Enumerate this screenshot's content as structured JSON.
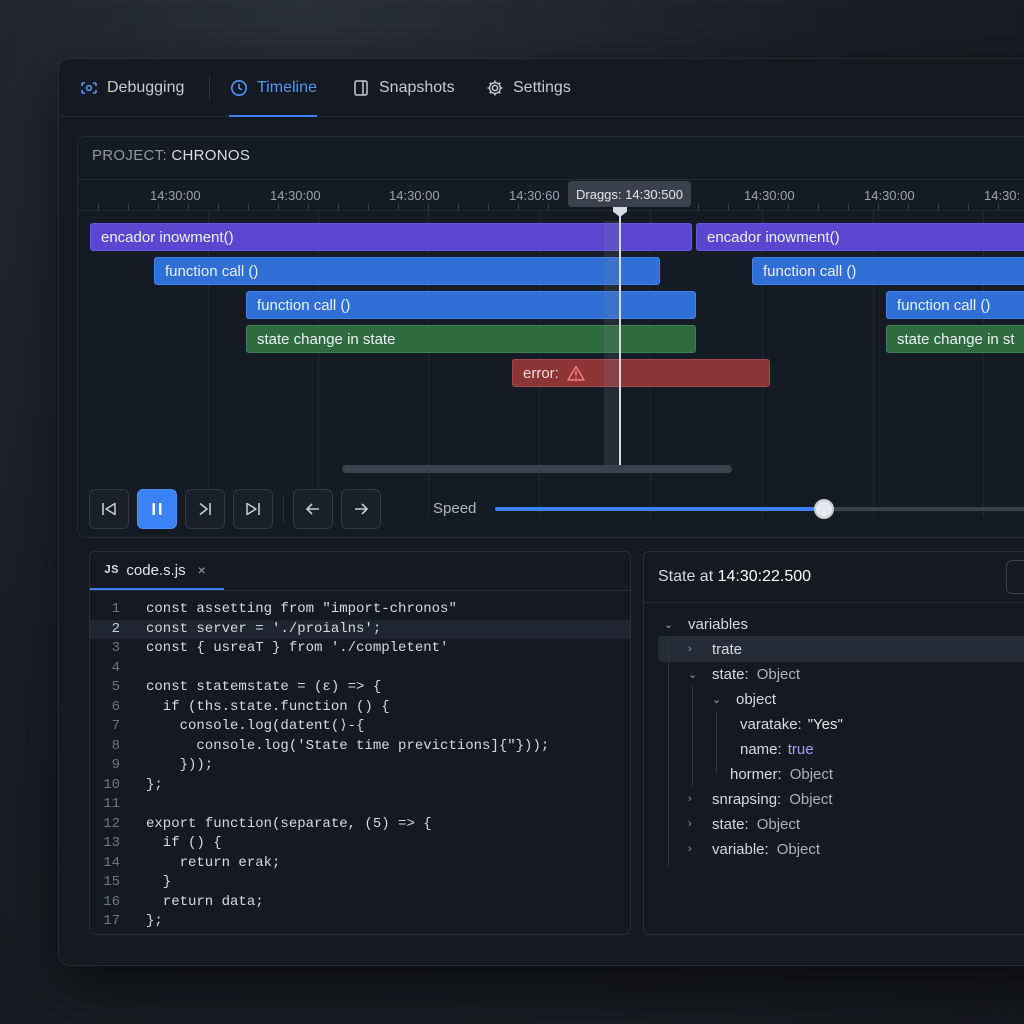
{
  "nav": {
    "items": [
      {
        "label": "Debugging",
        "icon": "debug-icon"
      },
      {
        "label": "Timeline",
        "icon": "clock-icon",
        "active": true
      },
      {
        "label": "Snapshots",
        "icon": "snapshot-icon"
      },
      {
        "label": "Settings",
        "icon": "gear-icon"
      }
    ]
  },
  "timeline": {
    "project_prefix": "PROJECT:",
    "project_name": "CHRONOS",
    "ticks": [
      "14:30:00",
      "14:30:00",
      "14:30:00",
      "14:30:60",
      "14:30:00",
      "14:30:00",
      "14:30:"
    ],
    "drag_tooltip": "Draggs: 14:30:500",
    "bars": [
      {
        "label": "encador inowment()",
        "kind": "purple"
      },
      {
        "label": "encador inowment()",
        "kind": "purple"
      },
      {
        "label": "function call ()",
        "kind": "blue"
      },
      {
        "label": "function call ()",
        "kind": "blue"
      },
      {
        "label": "function call ()",
        "kind": "blue"
      },
      {
        "label": "function call ()",
        "kind": "blue"
      },
      {
        "label": "state change in state",
        "kind": "green"
      },
      {
        "label": "state change in st",
        "kind": "green"
      },
      {
        "label": "error:",
        "kind": "red"
      }
    ],
    "colors": {
      "purple": "#5b47cf",
      "blue": "#2f6fd6",
      "green": "#2f6b3e",
      "red": "#8c3536",
      "accent": "#3b82f6"
    }
  },
  "controls": {
    "buttons": [
      "skip-to-start-icon",
      "pause-icon",
      "step-forward-icon",
      "skip-to-end-icon",
      "arrow-left-icon",
      "arrow-right-icon"
    ],
    "speed_label": "Speed",
    "speed_value": 0.6
  },
  "code": {
    "tab_badge": "JS",
    "tab_name": "code.s.js",
    "tab_close": "×",
    "highlighted_line": 2,
    "lines": [
      "const assetting from \"import-chronos\"",
      "const server = './proialns';",
      "const { usreaT } from './completent'",
      "",
      "const statemstate = (ε) => {",
      "  if (ths.state.function () {",
      "    console.log(datent(⟩-{",
      "      console.log('State time previctions]{\"}));",
      "    }));",
      "};",
      "",
      "export function(separate, (5) => {",
      "  if () {",
      "    return erak;",
      "  }",
      "  return data;",
      "};"
    ]
  },
  "state": {
    "title_prefix": "State at",
    "title_time": "14:30:22.500",
    "tree": [
      {
        "chev": "⌄",
        "key": "variables",
        "val": ""
      },
      {
        "chev": "›",
        "key": "trate",
        "val": ""
      },
      {
        "chev": "⌄",
        "key": "state:",
        "val": "Object"
      },
      {
        "chev": "⌄",
        "key": "object",
        "val": ""
      },
      {
        "chev": "",
        "key": "varatake:",
        "val": "\"Yes\""
      },
      {
        "chev": "",
        "key": "name:",
        "val": "true"
      },
      {
        "chev": "",
        "key": "hormer:",
        "val": "Object"
      },
      {
        "chev": "›",
        "key": "snrapsing:",
        "val": "Object"
      },
      {
        "chev": "›",
        "key": "state:",
        "val": "Object"
      },
      {
        "chev": "›",
        "key": "variable:",
        "val": "Object"
      }
    ]
  }
}
